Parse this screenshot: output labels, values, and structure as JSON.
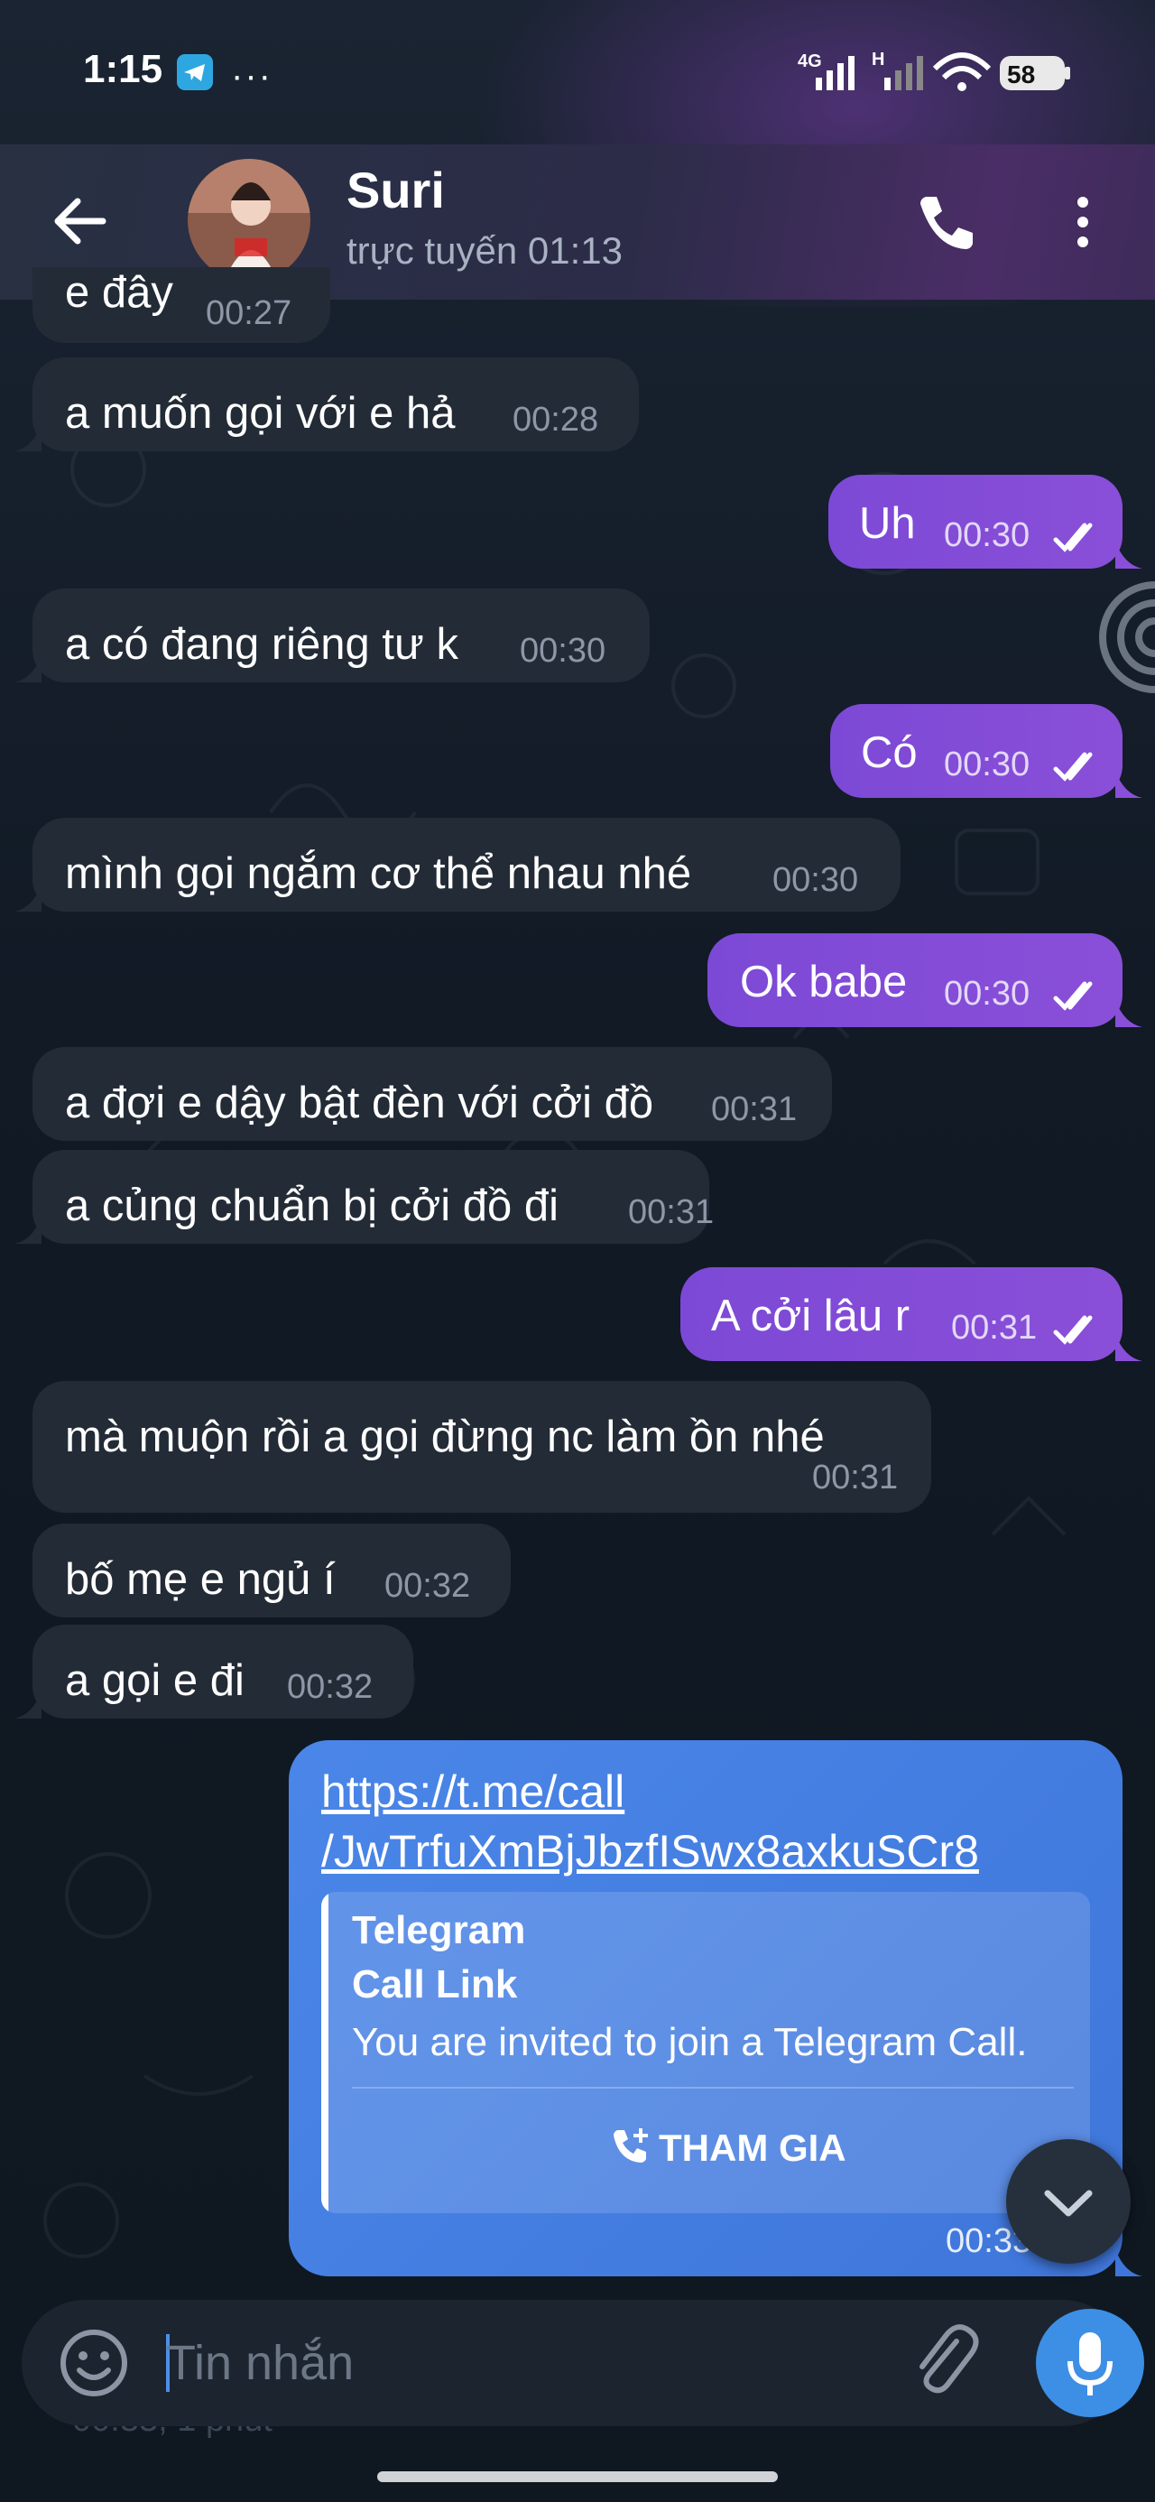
{
  "status_bar": {
    "time": "1:15",
    "notification_icons": [
      "telegram-icon",
      "more-notifications-icon"
    ],
    "network_labels": [
      "4G",
      "H"
    ],
    "battery": "58"
  },
  "header": {
    "contact_name": "Suri",
    "contact_status": "trực tuyến 01:13",
    "icons": [
      "back-arrow-icon",
      "avatar",
      "phone-icon",
      "more-vert-icon"
    ]
  },
  "messages": [
    {
      "dir": "in",
      "text": "e đây",
      "time": "00:27"
    },
    {
      "dir": "in",
      "text": "a muốn gọi với e hả",
      "time": "00:28"
    },
    {
      "dir": "out",
      "text": "Uh",
      "time": "00:30"
    },
    {
      "dir": "in",
      "text": "a có đang riêng tư k",
      "time": "00:30"
    },
    {
      "dir": "out",
      "text": "Có",
      "time": "00:30"
    },
    {
      "dir": "in",
      "text": "mình gọi ngắm cơ thể nhau nhé",
      "time": "00:30"
    },
    {
      "dir": "out",
      "text": "Ok babe",
      "time": "00:30"
    },
    {
      "dir": "in",
      "text": "a đợi e dậy bật đèn với cởi đồ",
      "time": "00:31"
    },
    {
      "dir": "in",
      "text": "a củng chuẩn bị cởi đồ đi",
      "time": "00:31"
    },
    {
      "dir": "out",
      "text": "A cởi lâu r",
      "time": "00:31"
    },
    {
      "dir": "in",
      "text": "mà muộn rồi a gọi đừng nc làm ồn nhé",
      "time": "00:31"
    },
    {
      "dir": "in",
      "text": "bố mẹ e ngủ í",
      "time": "00:32"
    },
    {
      "dir": "in",
      "text": "a gọi e đi",
      "time": "00:32"
    }
  ],
  "link_message": {
    "url_line1": "https://t.me/call",
    "url_line2": "/JwTrfuXmBjJbzfISwx8axkuSCr8",
    "preview_site": "Telegram",
    "preview_title": "Call Link",
    "preview_description": "You are invited to join a Telegram Call.",
    "join_label": "THAM GIA",
    "time": "00:33"
  },
  "composer": {
    "placeholder": "Tin nhắn",
    "under_text": "00:33, 1 phút",
    "icons": [
      "emoji-icon",
      "attach-icon",
      "mic-icon"
    ]
  },
  "colors": {
    "outgoing_bubble": "#7c49d6",
    "incoming_bubble": "#232b36",
    "link_bubble": "#4a86e8",
    "accent": "#3d8fe6"
  }
}
